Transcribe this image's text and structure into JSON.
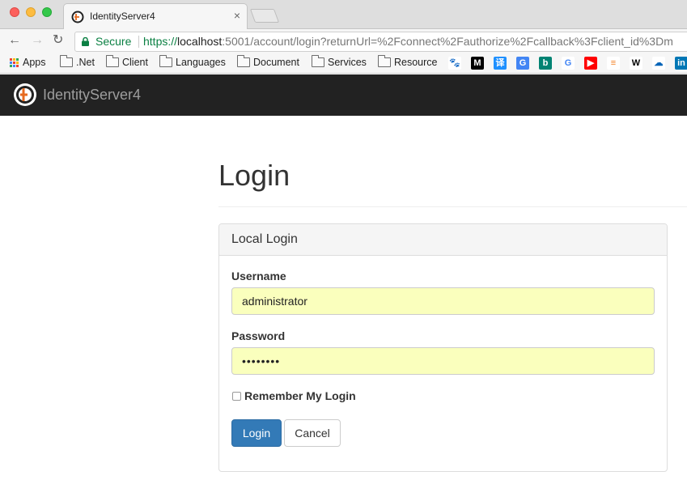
{
  "browser": {
    "tab_title": "IdentityServer4",
    "tab_close": "×",
    "nav": {
      "back": "←",
      "forward": "→",
      "reload": "↻"
    },
    "security_label": "Secure",
    "url_scheme": "https://",
    "url_host": "localhost",
    "url_path": ":5001/account/login?returnUrl=%2Fconnect%2Fauthorize%2Fcallback%3Fclient_id%3Dm",
    "bookmarks": {
      "apps": "Apps",
      "folders": [
        ".Net",
        "Client",
        "Languages",
        "Document",
        "Services",
        "Resource"
      ]
    },
    "bookmark_icons": [
      {
        "name": "baidu-icon",
        "glyph": "🐾",
        "bg": "#ffffff",
        "color": "#2932e1"
      },
      {
        "name": "medium-icon",
        "glyph": "M",
        "bg": "#000000",
        "color": "#ffffff"
      },
      {
        "name": "youdao-icon",
        "glyph": "译",
        "bg": "#1e90ff",
        "color": "#ffffff"
      },
      {
        "name": "google-translate-icon",
        "glyph": "G",
        "bg": "#4285f4",
        "color": "#ffffff"
      },
      {
        "name": "bing-icon",
        "glyph": "b",
        "bg": "#008373",
        "color": "#ffffff"
      },
      {
        "name": "google-icon",
        "glyph": "G",
        "bg": "#ffffff",
        "color": "#4285f4"
      },
      {
        "name": "youtube-icon",
        "glyph": "▶",
        "bg": "#ff0000",
        "color": "#ffffff"
      },
      {
        "name": "stackoverflow-icon",
        "glyph": "≡",
        "bg": "#ffffff",
        "color": "#f48024"
      },
      {
        "name": "wikipedia-icon",
        "glyph": "W",
        "bg": "#ffffff",
        "color": "#000000"
      },
      {
        "name": "onedrive-icon",
        "glyph": "☁",
        "bg": "#ffffff",
        "color": "#0364b8"
      },
      {
        "name": "linkedin-icon",
        "glyph": "in",
        "bg": "#0077b5",
        "color": "#ffffff"
      }
    ]
  },
  "navbar": {
    "brand": "IdentityServer4"
  },
  "page": {
    "title": "Login"
  },
  "panel": {
    "heading": "Local Login",
    "username_label": "Username",
    "username_value": "administrator",
    "password_label": "Password",
    "password_value": "••••••••",
    "remember_label": "Remember My Login",
    "remember_checked": false,
    "login_button": "Login",
    "cancel_button": "Cancel"
  },
  "colors": {
    "navbar_bg": "#222222",
    "primary": "#337ab7",
    "autofill_bg": "#faffbd",
    "secure_green": "#0b8043"
  }
}
